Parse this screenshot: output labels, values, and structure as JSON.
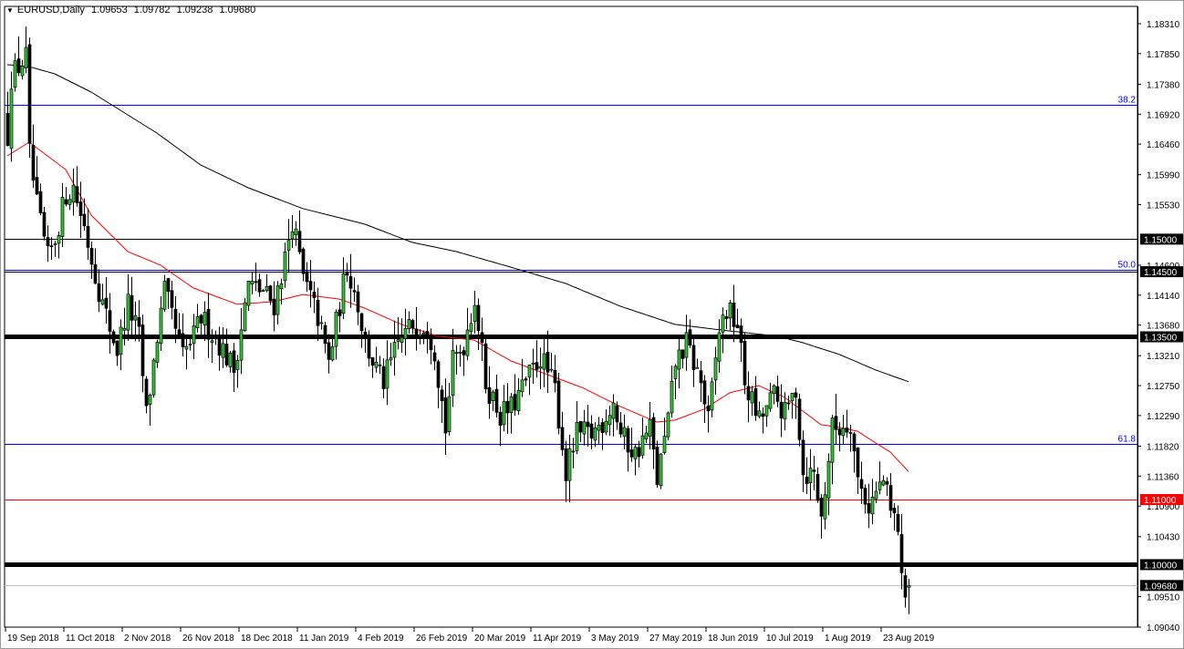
{
  "header": {
    "symbol": "EURUSD,Daily",
    "open": "1.09653",
    "high": "1.09782",
    "low": "1.09238",
    "close": "1.09680"
  },
  "chart_data": {
    "type": "candlestick",
    "symbol": "EURUSD",
    "timeframe": "Daily",
    "ylim": [
      1.0904,
      1.1831
    ],
    "y_ticks": [
      "1.18310",
      "1.17850",
      "1.17380",
      "1.16920",
      "1.16460",
      "1.15990",
      "1.15530",
      "1.14600",
      "1.14140",
      "1.13680",
      "1.13210",
      "1.12750",
      "1.12290",
      "1.11820",
      "1.11360",
      "1.10900",
      "1.10430",
      "1.09510",
      "1.09040"
    ],
    "x_ticks": [
      {
        "bar": 0,
        "label": "19 Sep 2018"
      },
      {
        "bar": 16,
        "label": "11 Oct 2018"
      },
      {
        "bar": 32,
        "label": "2 Nov 2018"
      },
      {
        "bar": 48,
        "label": "26 Nov 2018"
      },
      {
        "bar": 64,
        "label": "18 Dec 2018"
      },
      {
        "bar": 80,
        "label": "11 Jan 2019"
      },
      {
        "bar": 96,
        "label": "4 Feb 2019"
      },
      {
        "bar": 112,
        "label": "26 Feb 2019"
      },
      {
        "bar": 128,
        "label": "20 Mar 2019"
      },
      {
        "bar": 144,
        "label": "11 Apr 2019"
      },
      {
        "bar": 160,
        "label": "3 May 2019"
      },
      {
        "bar": 176,
        "label": "27 May 2019"
      },
      {
        "bar": 192,
        "label": "18 Jun 2019"
      },
      {
        "bar": 208,
        "label": "10 Jul 2019"
      },
      {
        "bar": 224,
        "label": "1 Aug 2019"
      },
      {
        "bar": 240,
        "label": "23 Aug 2019"
      }
    ],
    "close_anchors": [
      [
        0,
        1.166
      ],
      [
        1,
        1.175
      ],
      [
        5,
        1.178
      ],
      [
        6,
        1.163
      ],
      [
        8,
        1.155
      ],
      [
        11,
        1.147
      ],
      [
        13,
        1.15
      ],
      [
        16,
        1.157
      ],
      [
        18,
        1.158
      ],
      [
        21,
        1.152
      ],
      [
        23,
        1.147
      ],
      [
        26,
        1.14
      ],
      [
        30,
        1.133
      ],
      [
        33,
        1.14
      ],
      [
        36,
        1.135
      ],
      [
        38,
        1.123
      ],
      [
        41,
        1.135
      ],
      [
        43,
        1.142
      ],
      [
        46,
        1.136
      ],
      [
        48,
        1.132
      ],
      [
        51,
        1.135
      ],
      [
        53,
        1.138
      ],
      [
        58,
        1.134
      ],
      [
        62,
        1.13
      ],
      [
        66,
        1.143
      ],
      [
        70,
        1.142
      ],
      [
        73,
        1.14
      ],
      [
        76,
        1.147
      ],
      [
        78,
        1.153
      ],
      [
        81,
        1.144
      ],
      [
        85,
        1.138
      ],
      [
        88,
        1.131
      ],
      [
        91,
        1.14
      ],
      [
        93,
        1.146
      ],
      [
        96,
        1.14
      ],
      [
        98,
        1.134
      ],
      [
        101,
        1.13
      ],
      [
        103,
        1.128
      ],
      [
        107,
        1.134
      ],
      [
        111,
        1.137
      ],
      [
        115,
        1.137
      ],
      [
        117,
        1.133
      ],
      [
        120,
        1.121
      ],
      [
        122,
        1.131
      ],
      [
        125,
        1.134
      ],
      [
        128,
        1.141
      ],
      [
        131,
        1.128
      ],
      [
        135,
        1.123
      ],
      [
        138,
        1.124
      ],
      [
        142,
        1.128
      ],
      [
        146,
        1.132
      ],
      [
        150,
        1.127
      ],
      [
        153,
        1.114
      ],
      [
        156,
        1.12
      ],
      [
        160,
        1.12
      ],
      [
        163,
        1.122
      ],
      [
        166,
        1.125
      ],
      [
        168,
        1.12
      ],
      [
        172,
        1.117
      ],
      [
        176,
        1.121
      ],
      [
        178,
        1.113
      ],
      [
        181,
        1.122
      ],
      [
        183,
        1.131
      ],
      [
        186,
        1.134
      ],
      [
        190,
        1.128
      ],
      [
        192,
        1.122
      ],
      [
        195,
        1.136
      ],
      [
        197,
        1.139
      ],
      [
        200,
        1.137
      ],
      [
        202,
        1.128
      ],
      [
        206,
        1.122
      ],
      [
        210,
        1.126
      ],
      [
        213,
        1.123
      ],
      [
        216,
        1.127
      ],
      [
        218,
        1.114
      ],
      [
        221,
        1.114
      ],
      [
        223,
        1.107
      ],
      [
        226,
        1.121
      ],
      [
        228,
        1.121
      ],
      [
        231,
        1.122
      ],
      [
        233,
        1.113
      ],
      [
        236,
        1.109
      ],
      [
        240,
        1.113
      ],
      [
        242,
        1.108
      ],
      [
        244,
        1.106
      ],
      [
        245,
        1.097
      ],
      [
        246,
        1.0965
      ],
      [
        247,
        1.0968
      ]
    ],
    "last_candle": {
      "open": 1.09653,
      "high": 1.09782,
      "low": 1.09238,
      "close": 1.0968
    },
    "ma_fast": {
      "color": "#ff0000",
      "points": [
        [
          0,
          1.1628
        ],
        [
          6,
          1.1649
        ],
        [
          16,
          1.1607
        ],
        [
          23,
          1.1537
        ],
        [
          33,
          1.1481
        ],
        [
          42,
          1.146
        ],
        [
          51,
          1.1425
        ],
        [
          63,
          1.14
        ],
        [
          73,
          1.1404
        ],
        [
          81,
          1.1415
        ],
        [
          91,
          1.1408
        ],
        [
          98,
          1.1394
        ],
        [
          108,
          1.1369
        ],
        [
          118,
          1.1351
        ],
        [
          128,
          1.1345
        ],
        [
          138,
          1.1313
        ],
        [
          148,
          1.1292
        ],
        [
          158,
          1.1271
        ],
        [
          168,
          1.1243
        ],
        [
          178,
          1.1219
        ],
        [
          183,
          1.1222
        ],
        [
          191,
          1.1239
        ],
        [
          198,
          1.1264
        ],
        [
          206,
          1.1275
        ],
        [
          213,
          1.1257
        ],
        [
          218,
          1.1236
        ],
        [
          223,
          1.1215
        ],
        [
          228,
          1.1211
        ],
        [
          233,
          1.1205
        ],
        [
          238,
          1.1187
        ],
        [
          242,
          1.1173
        ],
        [
          247,
          1.1143
        ]
      ]
    },
    "ma_slow": {
      "color": "#000000",
      "points": [
        [
          0,
          1.1768
        ],
        [
          6,
          1.1765
        ],
        [
          13,
          1.1754
        ],
        [
          23,
          1.1726
        ],
        [
          31,
          1.1698
        ],
        [
          41,
          1.1663
        ],
        [
          53,
          1.1614
        ],
        [
          66,
          1.1579
        ],
        [
          81,
          1.1547
        ],
        [
          98,
          1.1523
        ],
        [
          111,
          1.1495
        ],
        [
          123,
          1.1481
        ],
        [
          138,
          1.1457
        ],
        [
          153,
          1.1432
        ],
        [
          168,
          1.1397
        ],
        [
          183,
          1.1369
        ],
        [
          198,
          1.1359
        ],
        [
          211,
          1.1351
        ],
        [
          218,
          1.1341
        ],
        [
          228,
          1.1323
        ],
        [
          238,
          1.1299
        ],
        [
          247,
          1.1281
        ]
      ]
    },
    "levels": [
      {
        "price": 1.1706,
        "color": "#0000ff",
        "width": 1,
        "label": "38.2"
      },
      {
        "price": 1.15,
        "color": "#000000",
        "width": 1,
        "badge": "1.15000",
        "badge_bg": "#000000"
      },
      {
        "price": 1.1453,
        "color": "#0000ff",
        "width": 1,
        "label": "50.0"
      },
      {
        "price": 1.145,
        "color": "#000000",
        "width": 1,
        "badge": "1.14500",
        "badge_bg": "#000000"
      },
      {
        "price": 1.135,
        "color": "#000000",
        "width": 5,
        "badge": "1.13500",
        "badge_bg": "#000000"
      },
      {
        "price": 1.1185,
        "color": "#0000ff",
        "width": 1,
        "label": "61.8"
      },
      {
        "price": 1.11,
        "color": "#ff0000",
        "width": 1,
        "badge": "1.11000",
        "badge_bg": "#ff0000"
      },
      {
        "price": 1.1,
        "color": "#000000",
        "width": 5,
        "badge": "1.10000",
        "badge_bg": "#000000"
      },
      {
        "price": 1.0968,
        "color": "#c0c0c0",
        "width": 1,
        "badge": "1.09680",
        "badge_bg": "#000000"
      }
    ],
    "colors": {
      "bull": "#32cd32",
      "bear": "#000000"
    }
  }
}
